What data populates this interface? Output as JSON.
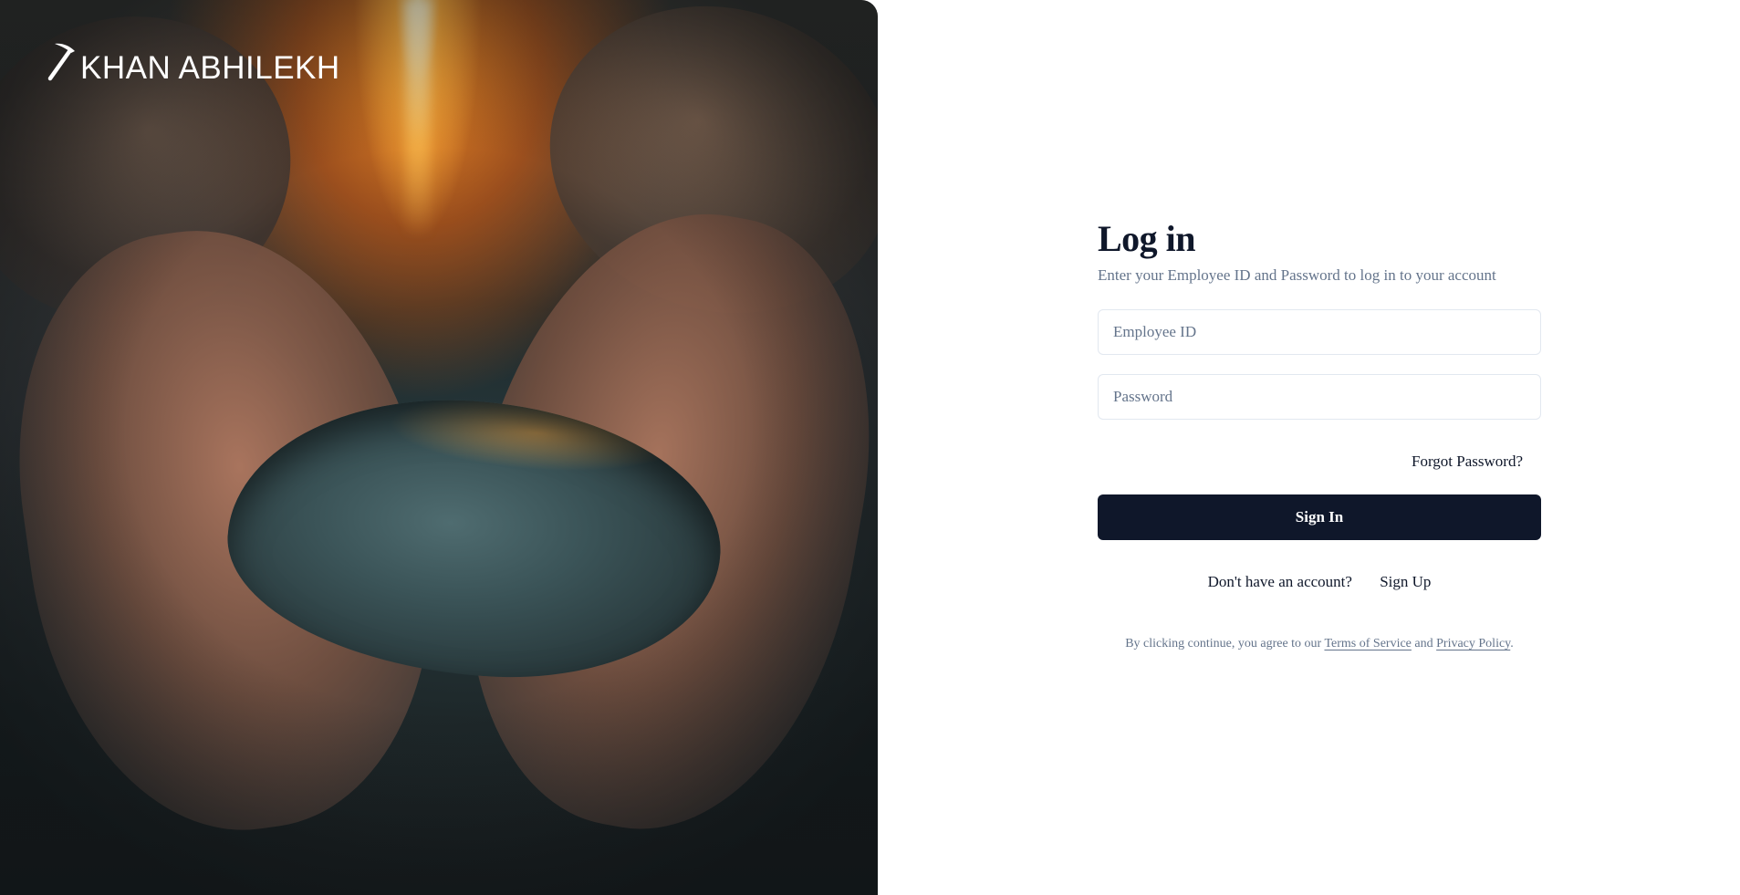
{
  "brand": {
    "name": "KHAN ABHILEKH",
    "logo_icon": "pickaxe-icon"
  },
  "hero": {
    "image_subject": "hands-holding-coal-image"
  },
  "login": {
    "title": "Log in",
    "subtitle": "Enter your Employee ID and Password to log in to your account",
    "employee_id": {
      "value": "",
      "placeholder": "Employee ID"
    },
    "password": {
      "value": "",
      "placeholder": "Password"
    },
    "forgot_password": "Forgot Password?",
    "sign_in": "Sign In",
    "no_account": "Don't have an account?",
    "sign_up": "Sign Up",
    "legal": {
      "prefix": "By clicking continue, you agree to our ",
      "terms": "Terms of Service",
      "and": " and ",
      "privacy": "Privacy Policy",
      "suffix": "."
    }
  },
  "colors": {
    "primary": "#0f172a",
    "muted_text": "#64748b",
    "border": "#e2e8f0",
    "background": "#ffffff"
  }
}
